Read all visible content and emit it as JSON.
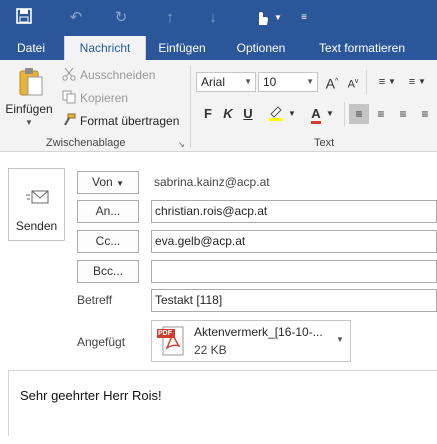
{
  "colors": {
    "accent": "#2b579a",
    "pdf_red": "#d03d2f",
    "paste_gold": "#e6b33c"
  },
  "quick_access": {
    "save_icon": "save-icon",
    "undo_icon": "undo-icon",
    "redo_icon": "redo-icon",
    "up_icon": "arrow-up-icon",
    "down_icon": "arrow-down-icon",
    "touch_icon": "touch-mode-icon",
    "customize_icon": "customize-icon"
  },
  "tabs": [
    "Datei",
    "Nachricht",
    "Einfügen",
    "Optionen",
    "Text formatieren"
  ],
  "active_tab": "Nachricht",
  "ribbon": {
    "clipboard": {
      "paste_label": "Einfügen",
      "cut_label": "Ausschneiden",
      "copy_label": "Kopieren",
      "format_painter_label": "Format übertragen",
      "group_label": "Zwischenablage"
    },
    "text": {
      "font_name": "Arial",
      "font_size": "10",
      "group_label": "Text"
    }
  },
  "compose": {
    "send_label": "Senden",
    "from_label": "Von",
    "from_value": "sabrina.kainz@acp.at",
    "to_label": "An...",
    "to_value": "christian.rois@acp.at",
    "cc_label": "Cc...",
    "cc_value": "eva.gelb@acp.at",
    "bcc_label": "Bcc...",
    "bcc_value": "",
    "subject_label": "Betreff",
    "subject_value": "Testakt [118]",
    "attached_label": "Angefügt",
    "attachment": {
      "name": "Aktenvermerk_[16-10-...",
      "size": "22 KB",
      "type_badge": "PDF"
    },
    "body_text": "Sehr geehrter Herr Rois!"
  }
}
